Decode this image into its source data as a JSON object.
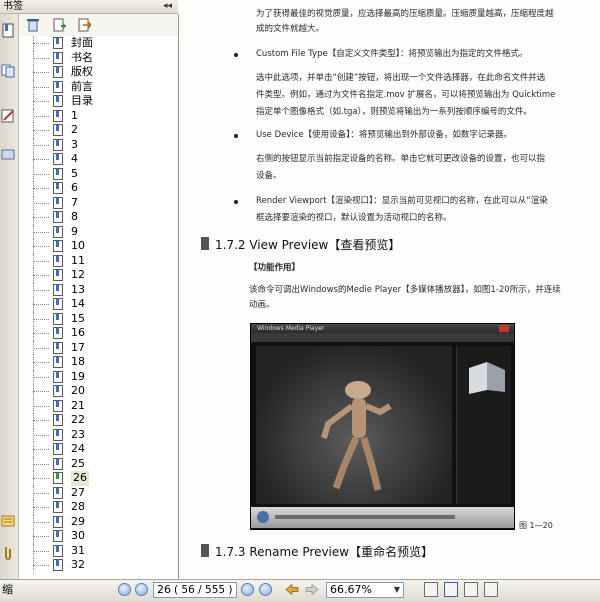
{
  "panel": {
    "title": "书签",
    "collapse_glyph": "◂◂"
  },
  "bookmarks": [
    {
      "label": "封面"
    },
    {
      "label": "书名"
    },
    {
      "label": "版权"
    },
    {
      "label": "前言"
    },
    {
      "label": "目录"
    },
    {
      "label": "1"
    },
    {
      "label": "2"
    },
    {
      "label": "3"
    },
    {
      "label": "4"
    },
    {
      "label": "5"
    },
    {
      "label": "6"
    },
    {
      "label": "7"
    },
    {
      "label": "8"
    },
    {
      "label": "9"
    },
    {
      "label": "10"
    },
    {
      "label": "11"
    },
    {
      "label": "12"
    },
    {
      "label": "13"
    },
    {
      "label": "14"
    },
    {
      "label": "15"
    },
    {
      "label": "16"
    },
    {
      "label": "17"
    },
    {
      "label": "18"
    },
    {
      "label": "19"
    },
    {
      "label": "20"
    },
    {
      "label": "21"
    },
    {
      "label": "22"
    },
    {
      "label": "23"
    },
    {
      "label": "24"
    },
    {
      "label": "25"
    },
    {
      "label": "26",
      "selected": true
    },
    {
      "label": "27"
    },
    {
      "label": "28"
    },
    {
      "label": "29"
    },
    {
      "label": "30"
    },
    {
      "label": "31"
    },
    {
      "label": "32"
    }
  ],
  "document": {
    "lines": [
      "为了获得最佳的视觉质量，应选择最高的压缩质量。压缩质量越高，压缩程度越",
      "成的文件就越大。",
      "Custom File Type【自定义文件类型】：将预览输出为指定的文件格式。",
      "选中此选项，并单击“创建”按钮，将出现一个文件选择器，在此命名文件并选",
      "件类型。例如，通过为文件名指定.mov 扩展名，可以将预览输出为 Quicktime",
      "指定单个图像格式（如.tga），则预览将输出为一系列按顺序编号的文件。",
      "Use Device【使用设备】：将预览输出到外部设备，如数字记录器。",
      "右侧的按钮显示当前指定设备的名称。单击它就可更改设备的设置，也可以指",
      "设备。",
      "Render Viewport【渲染视口】：显示当前可见视口的名称，在此可以从“渲染",
      "框选择要渲染的视口，默认设置为活动视口的名称。",
      "【功能作用】",
      "该命令可调出Windows的Medie Player【多媒体播放器】，如图1-20所示，并连续",
      "动画。"
    ],
    "section_1": "1.7.2  View Preview【查看预览】",
    "section_2": "1.7.3  Rename Preview【重命名预览】",
    "figure_caption": "图  1—20",
    "player_title": "Windows Media Player"
  },
  "status": {
    "left_label": "缩",
    "page_value": "26",
    "page_info": "( 56 / 555 )",
    "zoom_value": "66.67%"
  },
  "colors": {
    "panel_bg": "#ffffff",
    "toolbar_bg": "#ece9d8",
    "selection": "#e8e6d8",
    "accent": "#3a6fc4"
  }
}
